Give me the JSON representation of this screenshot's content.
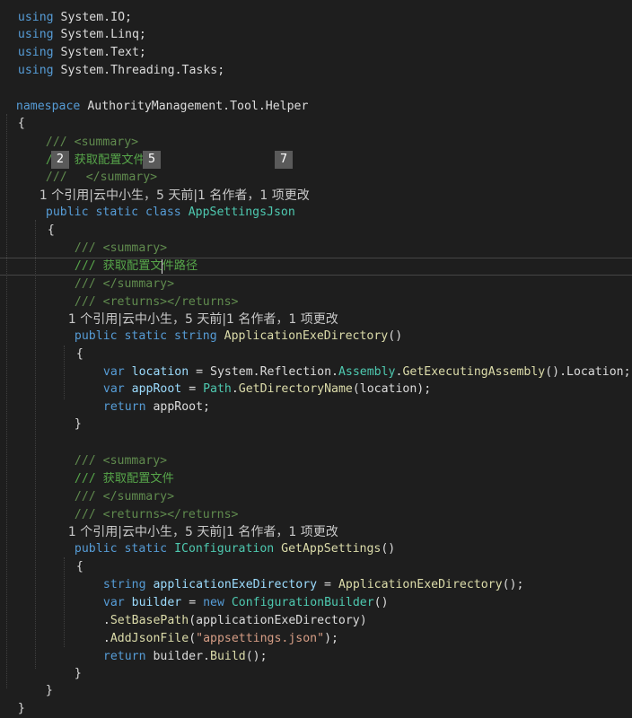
{
  "editor": {
    "usings": [
      {
        "kw": "using",
        "ns": "System.IO;"
      },
      {
        "kw": "using",
        "ns": "System.Linq;"
      },
      {
        "kw": "using",
        "ns": "System.Text;"
      },
      {
        "kw": "using",
        "ns": "System.Threading.Tasks;"
      }
    ],
    "namespace": {
      "kw": "namespace",
      "name": "AuthorityManagement.Tool.Helper"
    },
    "brace_open": "{",
    "brace_close": "}",
    "doc_summary_open": "/// <summary>",
    "doc_summary_close": "/// </summary>",
    "doc_returns": "/// <returns></returns>",
    "class_summary": "/// 获取配置文件类",
    "class_summary_close_fragment": "///",
    "class_summary_close_tail": "</summary>",
    "codelens": "1 个引用|云中小生，5 天前|1 名作者，1 项更改",
    "class_decl": {
      "kw": "public static class",
      "name": "AppSettingsJson"
    },
    "method1": {
      "summary": "/// 获取配置文件路径",
      "kw": "public static string",
      "name": "ApplicationExeDirectory",
      "paren": "()",
      "line1": {
        "var": "var",
        "name": "location",
        "eq": " = ",
        "a": "System.Reflection.",
        "b": "Assembly",
        "c": ".",
        "d": "GetExecutingAssembly",
        "e": "().Location;"
      },
      "line2": {
        "var": "var",
        "name": "appRoot",
        "eq": " = ",
        "a": "Path",
        "b": ".",
        "c": "GetDirectoryName",
        "d": "(location);"
      },
      "line3": {
        "kw": "return",
        "rest": " appRoot;"
      }
    },
    "method2": {
      "summary": "/// 获取配置文件",
      "kw": "public static",
      "type": "IConfiguration",
      "name": "GetAppSettings",
      "paren": "()",
      "line1": {
        "kw": "string",
        "name": "applicationExeDirectory",
        "eq": " = ",
        "fn": "ApplicationExeDirectory",
        "rest": "();"
      },
      "line2": {
        "var": "var",
        "name": "builder",
        "eq": " = ",
        "kw_new": "new",
        "ty": "ConfigurationBuilder",
        "rest": "()"
      },
      "line3": {
        "dot": ".",
        "fn": "SetBasePath",
        "rest": "(applicationExeDirectory)"
      },
      "line4": {
        "dot": ".",
        "fn": "AddJsonFile",
        "open": "(",
        "str": "\"appsettings.json\"",
        "close": ");"
      },
      "line5": {
        "kw": "return",
        "rest": " builder.",
        "fn": "Build",
        "end": "();"
      }
    },
    "partial_top": "using System.IO;"
  },
  "annotations": [
    "2",
    "5",
    "7"
  ]
}
